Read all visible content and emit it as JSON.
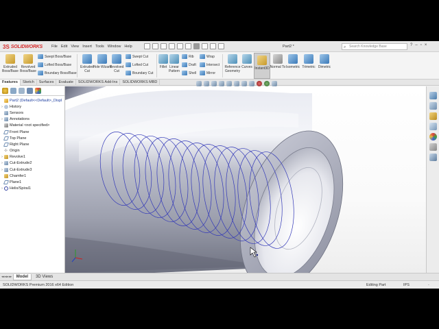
{
  "app": {
    "brand": "SOLIDWORKS",
    "brand_mark": "3S",
    "doc_title": "Part2 *"
  },
  "menus": [
    "File",
    "Edit",
    "View",
    "Insert",
    "Tools",
    "Window",
    "Help"
  ],
  "search": {
    "placeholder": "Search Knowledge Base"
  },
  "commands": {
    "extruded_boss": "Extruded Boss/Base",
    "revolved_boss": "Revolved Boss/Base",
    "swept_boss": "Swept Boss/Base",
    "lofted_boss": "Lofted Boss/Base",
    "boundary_boss": "Boundary Boss/Base",
    "extruded_cut": "Extruded Cut",
    "hole_wizard": "Hole Wizard",
    "revolved_cut": "Revolved Cut",
    "swept_cut": "Swept Cut",
    "lofted_cut": "Lofted Cut",
    "boundary_cut": "Boundary Cut",
    "fillet": "Fillet",
    "linear_pattern": "Linear Pattern",
    "rib": "Rib",
    "draft": "Draft",
    "shell": "Shell",
    "wrap": "Wrap",
    "intersect": "Intersect",
    "mirror": "Mirror",
    "reference_geometry": "Reference Geometry",
    "curves": "Curves",
    "instant3d": "Instant3D",
    "normal_to": "Normal To",
    "isometric": "Isometric",
    "trimetric": "Trimetric",
    "dimetric": "Dimetric"
  },
  "tabs": [
    "Features",
    "Sketch",
    "Surfaces",
    "Evaluate",
    "SOLIDWORKS Add-Ins",
    "SOLIDWORKS MBD"
  ],
  "tree": [
    {
      "label": "Part2  (Default<<Default>_Displ",
      "icon": "part-icon",
      "expander": ""
    },
    {
      "label": "History",
      "icon": "history-icon",
      "expander": "›"
    },
    {
      "label": "Sensors",
      "icon": "sensor-icon",
      "expander": ""
    },
    {
      "label": "Annotations",
      "icon": "annotations-icon",
      "expander": "›"
    },
    {
      "label": "Material <not specified>",
      "icon": "material-icon",
      "expander": ""
    },
    {
      "label": "Front Plane",
      "icon": "plane-icon",
      "expander": ""
    },
    {
      "label": "Top Plane",
      "icon": "plane-icon",
      "expander": ""
    },
    {
      "label": "Right Plane",
      "icon": "plane-icon",
      "expander": ""
    },
    {
      "label": "Origin",
      "icon": "origin-icon",
      "expander": ""
    },
    {
      "label": "Revolve1",
      "icon": "revolve-icon",
      "expander": "›"
    },
    {
      "label": "Cut-Extrude2",
      "icon": "cut-icon",
      "expander": "›"
    },
    {
      "label": "Cut-Extrude3",
      "icon": "cut-icon",
      "expander": "›"
    },
    {
      "label": "Chamfer1",
      "icon": "chamfer-icon",
      "expander": ""
    },
    {
      "label": "Plane1",
      "icon": "plane-icon",
      "expander": ""
    },
    {
      "label": "Helix/Spiral1",
      "icon": "helix-icon",
      "expander": "›"
    }
  ],
  "bottom_tabs": {
    "nav": "◂◂ ◂ ▸ ▸▸",
    "model": "Model",
    "views3d": "3D Views"
  },
  "status": {
    "left": "SOLIDWORKS Premium 2016 x64 Edition",
    "mode": "Editing Part",
    "units": "IPS",
    "extra": "-"
  }
}
